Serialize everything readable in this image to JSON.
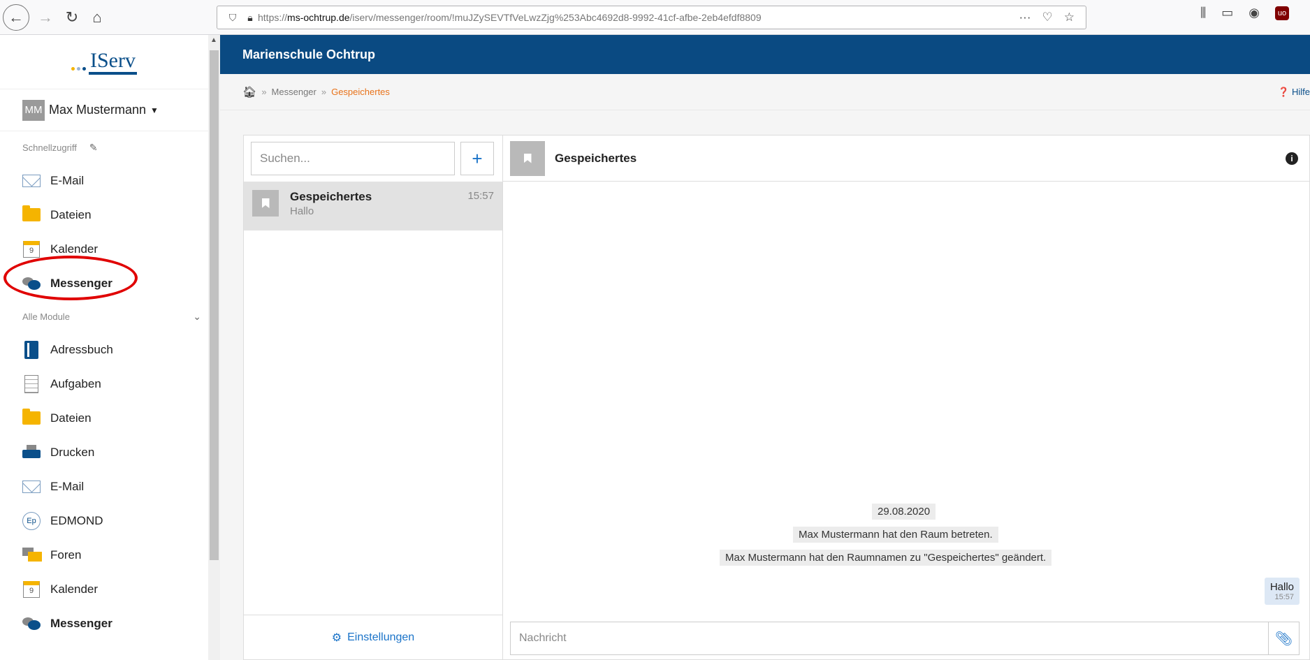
{
  "browser": {
    "url_prefix": "https://",
    "url_host": "ms-ochtrup.de",
    "url_path": "/iserv/messenger/room/!muJZySEVTfVeLwzZjg%253Abc4692d8-9992-41cf-afbe-2eb4efdf8809",
    "more": "···",
    "ublock_label": "uo"
  },
  "logo": {
    "text": "IServ",
    "dot_colors": [
      "#f5b400",
      "#9ab4d6",
      "#0a4f8a"
    ]
  },
  "user": {
    "initials": "MM",
    "name": "Max Mustermann"
  },
  "quick_access": {
    "label": "Schnellzugriff",
    "items": [
      {
        "label": "E-Mail"
      },
      {
        "label": "Dateien"
      },
      {
        "label": "Kalender",
        "day": "9"
      },
      {
        "label": "Messenger"
      }
    ]
  },
  "all_modules": {
    "label": "Alle Module",
    "items": [
      {
        "label": "Adressbuch"
      },
      {
        "label": "Aufgaben"
      },
      {
        "label": "Dateien"
      },
      {
        "label": "Drucken"
      },
      {
        "label": "E-Mail"
      },
      {
        "label": "EDMOND",
        "icon_text": "Ep"
      },
      {
        "label": "Foren"
      },
      {
        "label": "Kalender",
        "day": "9"
      },
      {
        "label": "Messenger"
      }
    ]
  },
  "header": {
    "title": "Marienschule Ochtrup"
  },
  "breadcrumb": {
    "sep": "»",
    "items": [
      "Messenger",
      "Gespeichertes"
    ],
    "help": "Hilfe"
  },
  "rooms": {
    "search_placeholder": "Suchen...",
    "add_label": "+",
    "list": [
      {
        "name": "Gespeichertes",
        "last_message": "Hallo",
        "time": "15:57"
      }
    ],
    "settings_label": "Einstellungen"
  },
  "chat": {
    "title": "Gespeichertes",
    "date": "29.08.2020",
    "system_messages": [
      "Max Mustermann hat den Raum betreten.",
      "Max Mustermann hat den Raumnamen zu \"Gespeichertes\" geändert."
    ],
    "my_message": {
      "text": "Hallo",
      "time": "15:57"
    },
    "composer_placeholder": "Nachricht"
  },
  "colors": {
    "brand": "#0a4a82",
    "accent": "#e8731b",
    "highlight": "#e00000"
  }
}
